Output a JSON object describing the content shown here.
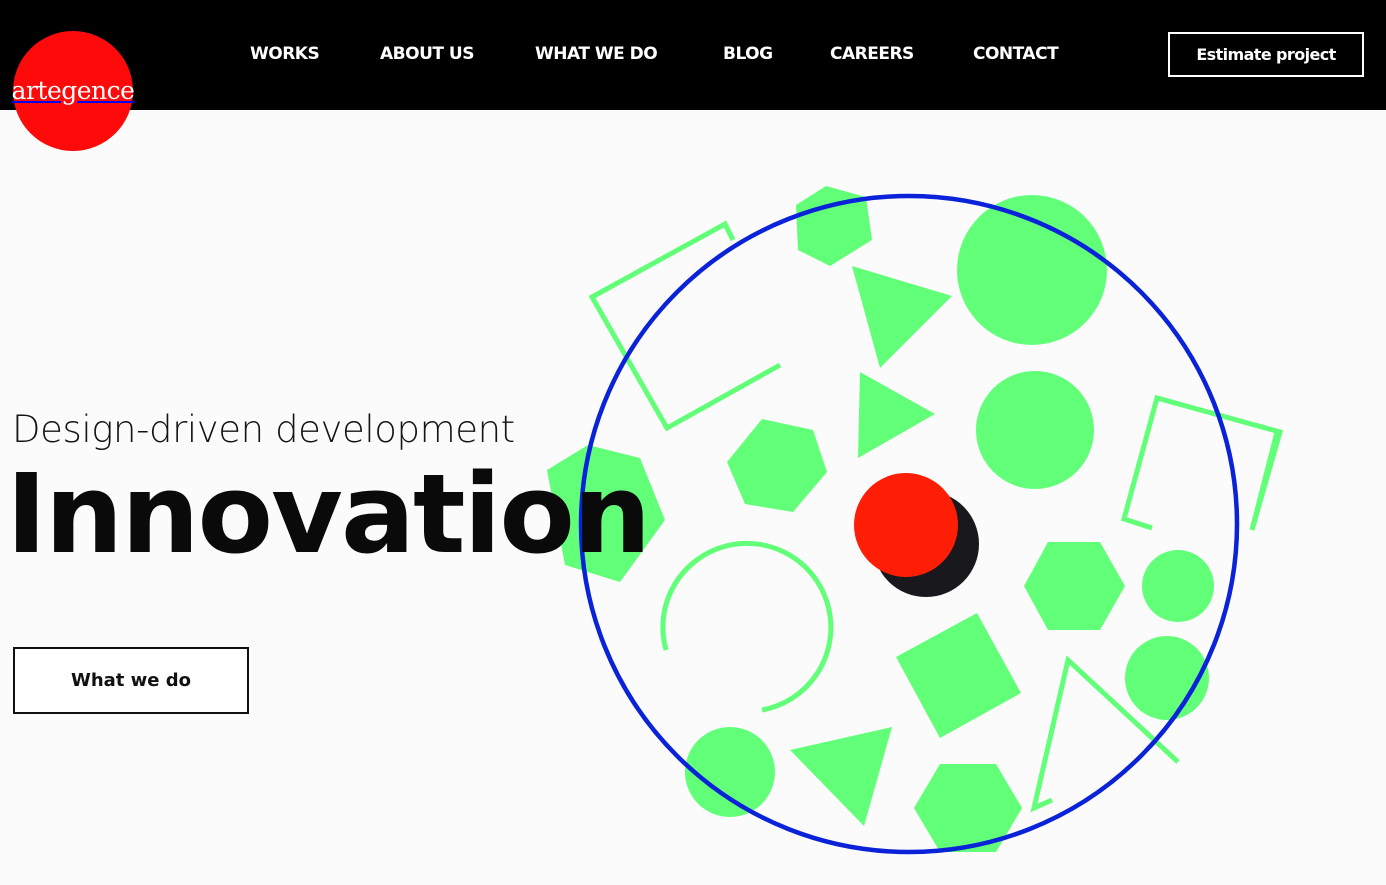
{
  "brand": {
    "logo_text": "artegence",
    "color": "#fe0a0a"
  },
  "nav": {
    "items": [
      {
        "label": "WORKS"
      },
      {
        "label": "ABOUT US"
      },
      {
        "label": "WHAT WE DO"
      },
      {
        "label": "BLOG"
      },
      {
        "label": "CAREERS"
      },
      {
        "label": "CONTACT"
      }
    ],
    "cta_label": "Estimate project"
  },
  "hero": {
    "subtitle": "Design-driven development",
    "headline": "Innovation",
    "button_label": "What we do"
  },
  "colors": {
    "shape_green": "#62ff79",
    "ring_blue": "#0a23d8",
    "dot_red": "#fe1e06",
    "dot_shadow": "#18181d",
    "header_bg": "#000000"
  }
}
